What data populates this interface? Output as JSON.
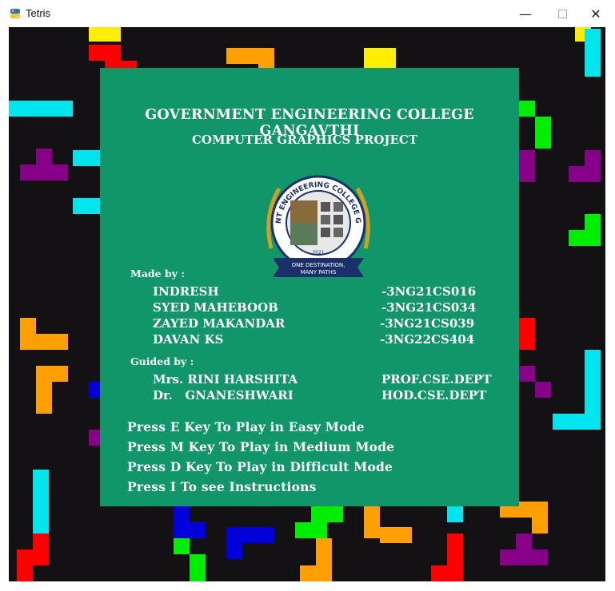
{
  "window": {
    "title": "Tetris",
    "minimize_glyph": "—",
    "close_glyph": "✕"
  },
  "colors": {
    "panel": "#109669",
    "background": "#141114",
    "red": "#ff0000",
    "cyan": "#00e5ee",
    "orange": "#ffa000",
    "yellow": "#ffee00",
    "green": "#00ee00",
    "purple": "#880088",
    "blue": "#0000dd"
  },
  "menu": {
    "college": "GOVERNMENT ENGINEERING COLLEGE GANGAVTHI",
    "project": "COMPUTER GRAPHICS PROJECT",
    "logo_text": {
      "ring": "GOVERNMENT ENGINEERING COLLEGE GANGAVATHI",
      "year": "2021",
      "motto_line1": "ONE DESTINATION,",
      "motto_line2": "MANY PATHS"
    },
    "made_by_label": "Made by :",
    "members": [
      {
        "name": "INDRESH",
        "usn": "-3NG21CS016"
      },
      {
        "name": "SYED MAHEBOOB",
        "usn": "-3NG21CS034"
      },
      {
        "name": "ZAYED MAKANDAR",
        "usn": "-3NG21CS039"
      },
      {
        "name": "DAVAN KS",
        "usn": "-3NG22CS404"
      }
    ],
    "guided_by_label": "Guided by :",
    "guides": [
      {
        "name": "Mrs. RINI HARSHITA",
        "role": "PROF.CSE.DEPT"
      },
      {
        "name": "Dr.   GNANESHWARI",
        "role": "HOD.CSE.DEPT"
      }
    ],
    "instructions": [
      "Press E Key To Play in Easy Mode",
      "Press M Key To Play in Medium Mode",
      "Press D Key To Play in Difficult Mode",
      "Press I To see Instructions"
    ]
  }
}
